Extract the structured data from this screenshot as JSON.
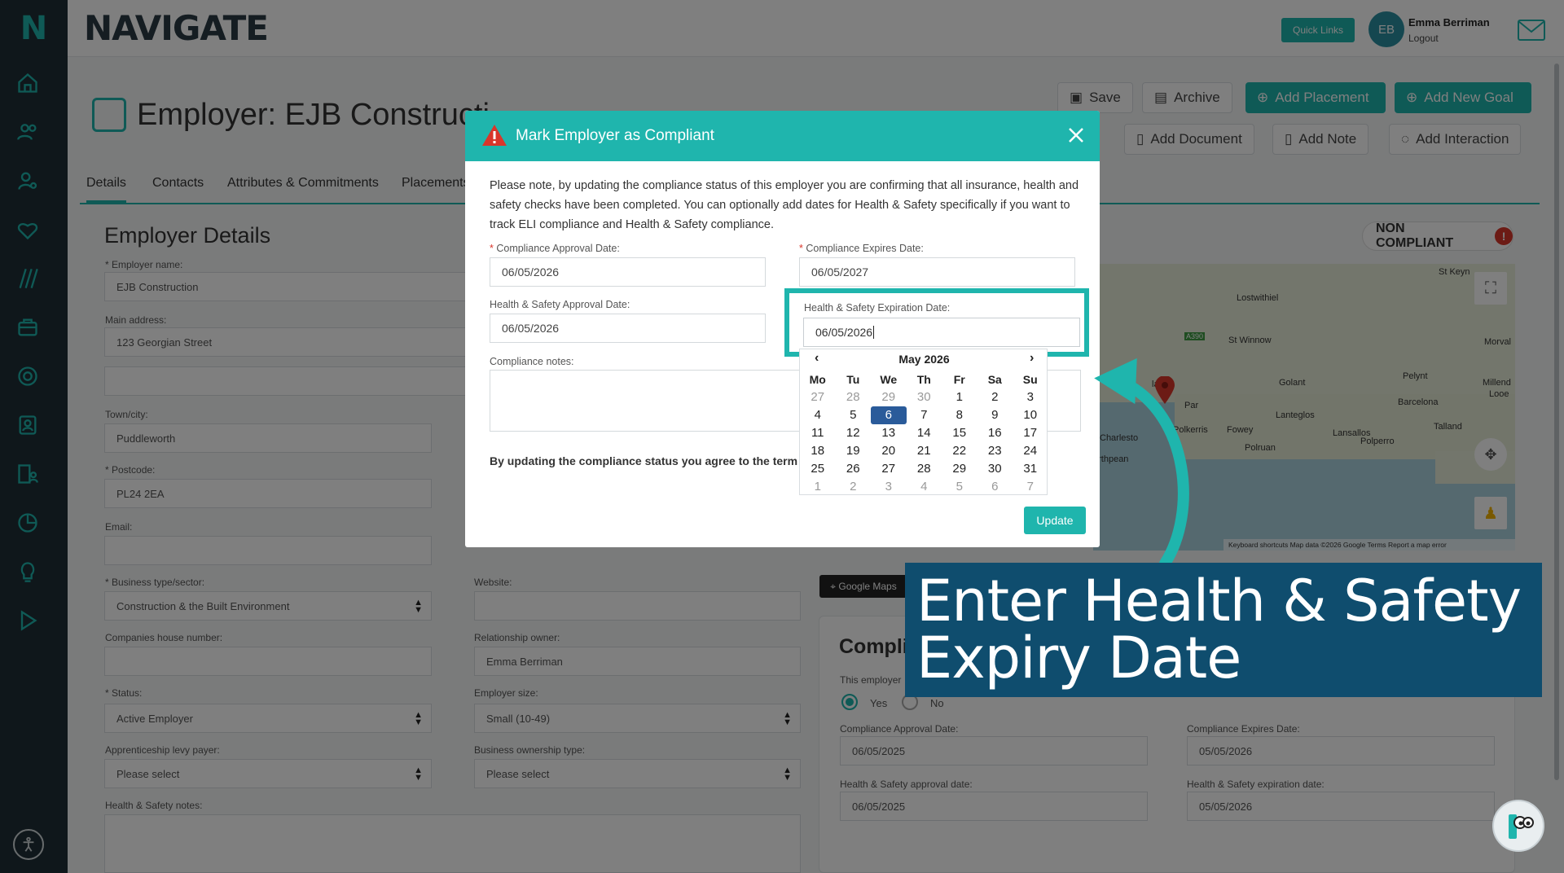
{
  "header": {
    "brand": "NAVIGATE",
    "quick_links": "Quick Links",
    "user_initials": "EB",
    "user_name": "Emma Berriman",
    "logout": "Logout"
  },
  "page": {
    "title": "Employer: EJB Constructi",
    "actions": {
      "save": "Save",
      "archive": "Archive",
      "add_placement": "Add Placement",
      "add_new_goal": "Add New Goal",
      "add_document": "Add Document",
      "add_note": "Add Note",
      "add_interaction": "Add Interaction"
    },
    "tabs": [
      "Details",
      "Contacts",
      "Attributes & Commitments",
      "Placements"
    ],
    "section_title": "Employer Details",
    "status_badge": "NON COMPLIANT",
    "badge_icon": "!"
  },
  "form": {
    "employer_name_label": "* Employer name:",
    "employer_name": "EJB Construction",
    "main_address_label": "Main address:",
    "main_address": "123 Georgian Street",
    "town_label": "Town/city:",
    "town": "Puddleworth",
    "postcode_label": "* Postcode:",
    "postcode": "PL24 2EA",
    "email_label": "Email:",
    "business_type_label": "* Business type/sector:",
    "business_type": "Construction & the Built Environment",
    "website_label": "Website:",
    "companies_house_label": "Companies house number:",
    "relationship_owner_label": "Relationship owner:",
    "relationship_owner": "Emma Berriman",
    "status_label": "* Status:",
    "status": "Active Employer",
    "employer_size_label": "Employer size:",
    "employer_size": "Small (10-49)",
    "levy_label": "Apprenticeship levy payer:",
    "levy": "Please select",
    "ownership_label": "Business ownership type:",
    "ownership": "Please select",
    "hs_notes_label": "Health & Safety notes:"
  },
  "map": {
    "google_maps_btn": "Google Maps",
    "labels": [
      "St Keyn",
      "Lostwithiel",
      "St Winnow",
      "Golant",
      "Pelynt",
      "Morval",
      "Millend",
      "Looe",
      "Barcelona",
      "Polkerris",
      "Fowey",
      "Lanteglos",
      "Lansallos",
      "Talland",
      "Polruan",
      "Polperro",
      "Charlesto",
      "orthpean",
      "lazey",
      "Par",
      "A390"
    ],
    "footer": "Keyboard shortcuts   Map data ©2026 Google   Terms   Report a map error"
  },
  "compliance_card": {
    "title": "Compli",
    "question": "This employer",
    "yes": "Yes",
    "no": "No",
    "approval_label": "Compliance Approval Date:",
    "approval": "06/05/2025",
    "expires_label": "Compliance Expires Date:",
    "expires": "05/05/2026",
    "hs_approval_label": "Health & Safety approval date:",
    "hs_approval": "06/05/2025",
    "hs_expiration_label": "Health & Safety expiration date:",
    "hs_expiration": "05/05/2026"
  },
  "modal": {
    "title": "Mark Employer as Compliant",
    "text": "Please note, by updating the compliance status of this employer you are confirming that all insurance, health and safety checks have been completed. You can optionally add dates for Health & Safety specifically if you want to track ELI compliance and Health & Safety compliance.",
    "approval_label": "Compliance Approval Date:",
    "approval": "06/05/2026",
    "expires_label": "Compliance Expires Date:",
    "expires": "06/05/2027",
    "hs_approval_label": "Health & Safety Approval Date:",
    "hs_approval": "06/05/2026",
    "hs_expiration_label": "Health & Safety Expiration Date:",
    "hs_expiration": "06/05/2026",
    "notes_label": "Compliance notes:",
    "agree_text": "By updating the compliance status you agree to the term",
    "update_btn": "Update"
  },
  "datepicker": {
    "month": "May 2026",
    "prev": "‹",
    "next": "›",
    "weekdays": [
      "Mo",
      "Tu",
      "We",
      "Th",
      "Fr",
      "Sa",
      "Su"
    ],
    "weeks": [
      [
        "27",
        "28",
        "29",
        "30",
        "1",
        "2",
        "3"
      ],
      [
        "4",
        "5",
        "6",
        "7",
        "8",
        "9",
        "10"
      ],
      [
        "11",
        "12",
        "13",
        "14",
        "15",
        "16",
        "17"
      ],
      [
        "18",
        "19",
        "20",
        "21",
        "22",
        "23",
        "24"
      ],
      [
        "25",
        "26",
        "27",
        "28",
        "29",
        "30",
        "31"
      ],
      [
        "1",
        "2",
        "3",
        "4",
        "5",
        "6",
        "7"
      ]
    ],
    "selected": "6"
  },
  "callout": {
    "line1": "Enter Health & Safety",
    "line2": "Expiry Date"
  },
  "colors": {
    "accent": "#1fb5ad",
    "sidebar": "#1f2f36",
    "callout": "#0f4d6e",
    "danger": "#d9362b",
    "selected_day": "#2a5b9a"
  }
}
